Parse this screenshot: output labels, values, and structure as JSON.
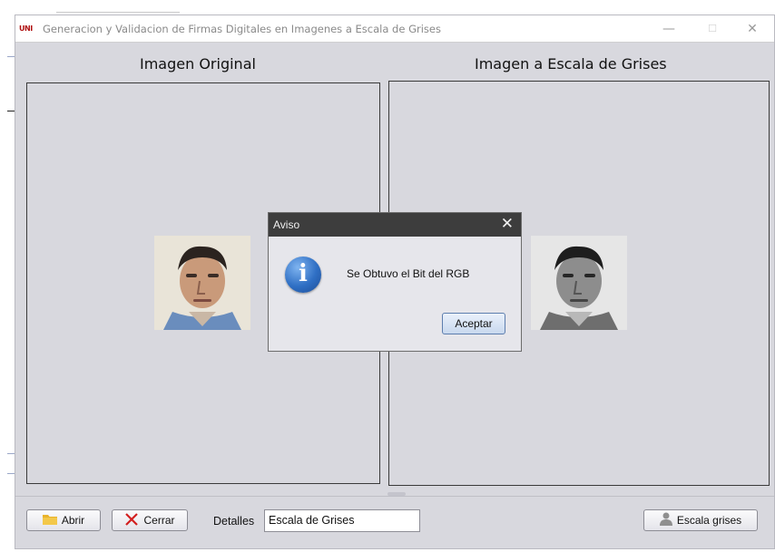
{
  "window": {
    "title": "Generacion y Validacion de Firmas Digitales en Imagenes a Escala de Grises",
    "app_icon_text": "UNI",
    "min_glyph": "—",
    "max_glyph": "☐",
    "close_glyph": "✕"
  },
  "panels": {
    "left_title": "Imagen Original",
    "right_title": "Imagen a Escala de Grises"
  },
  "toolbar": {
    "abrir_label": "Abrir",
    "cerrar_label": "Cerrar",
    "detalles_label": "Detalles",
    "detalles_value": "Escala de Grises",
    "escala_label": "Escala grises"
  },
  "dialog": {
    "title": "Aviso",
    "close_glyph": "✕",
    "message": "Se Obtuvo el Bit del RGB",
    "ok_label": "Aceptar",
    "icon_glyph": "i"
  },
  "icons": {
    "abrir": "folder-icon",
    "cerrar": "x-icon",
    "escala": "user-icon",
    "dialog": "info-icon"
  }
}
